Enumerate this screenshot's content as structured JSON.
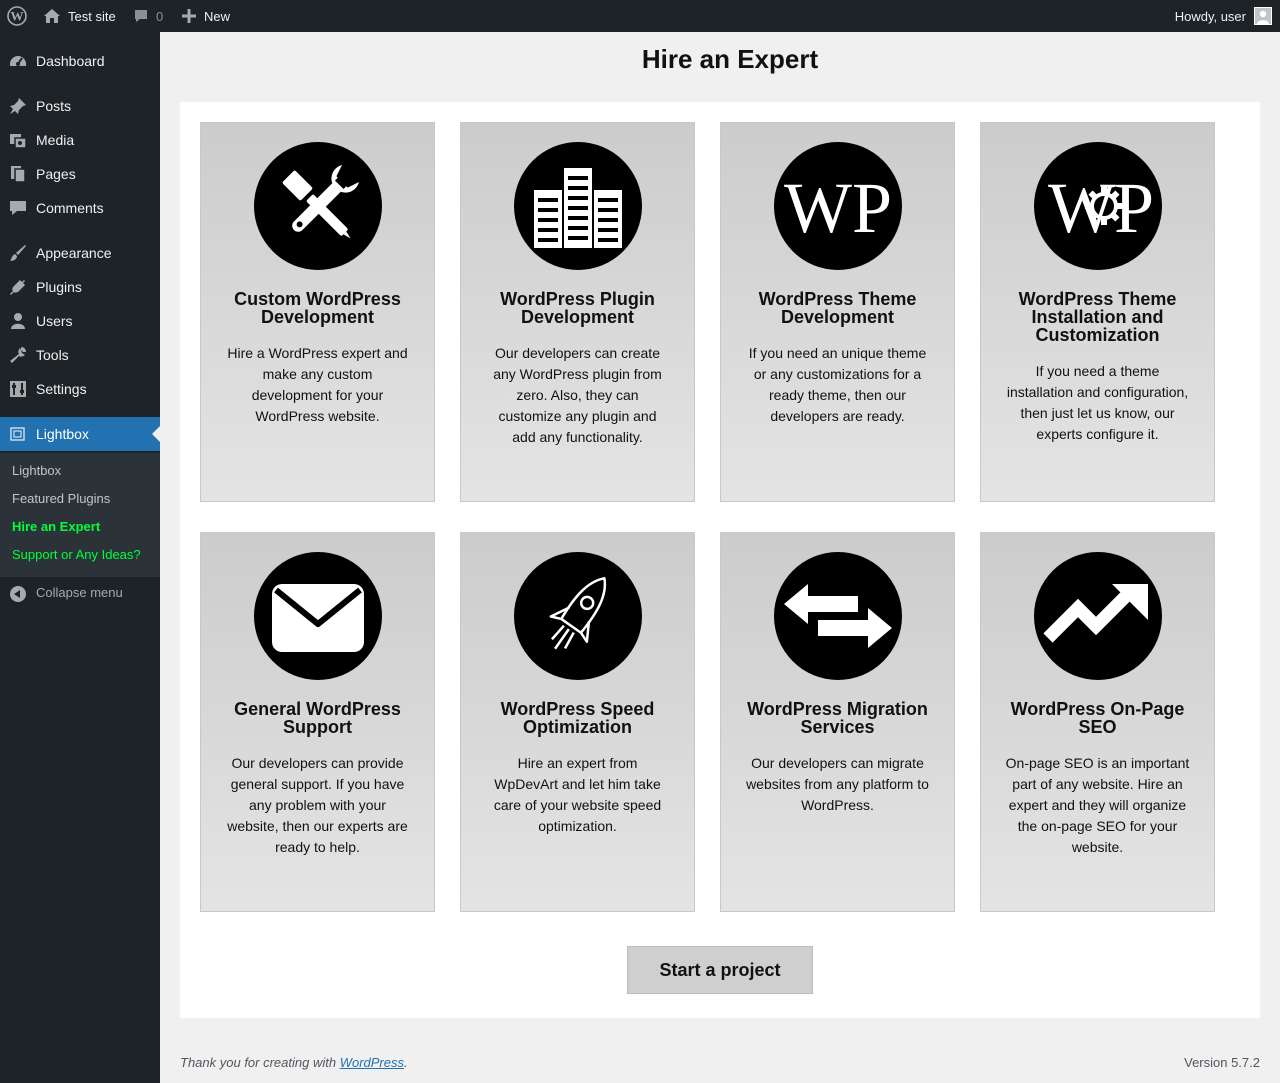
{
  "admin_bar": {
    "wp_logo": "wordpress-icon",
    "site_name": "Test site",
    "comments_count": "0",
    "new_label": "New",
    "greeting": "Howdy, user"
  },
  "sidebar": {
    "items": [
      {
        "label": "Dashboard",
        "icon": "dashboard-icon"
      },
      {
        "label": "Posts",
        "icon": "pin-icon"
      },
      {
        "label": "Media",
        "icon": "media-icon"
      },
      {
        "label": "Pages",
        "icon": "pages-icon"
      },
      {
        "label": "Comments",
        "icon": "comment-icon"
      },
      {
        "label": "Appearance",
        "icon": "brush-icon"
      },
      {
        "label": "Plugins",
        "icon": "plug-icon"
      },
      {
        "label": "Users",
        "icon": "user-icon"
      },
      {
        "label": "Tools",
        "icon": "wrench-icon"
      },
      {
        "label": "Settings",
        "icon": "sliders-icon"
      },
      {
        "label": "Lightbox",
        "icon": "lightbox-icon"
      }
    ],
    "submenu": [
      "Lightbox",
      "Featured Plugins",
      "Hire an Expert",
      "Support or Any Ideas?"
    ],
    "collapse_label": "Collapse menu"
  },
  "page": {
    "title": "Hire an Expert",
    "cards": [
      {
        "title": "Custom WordPress Development",
        "text": "Hire a WordPress expert and make any custom development for your WordPress website.",
        "icon": "tools-icon"
      },
      {
        "title": "WordPress Plugin Development",
        "text": "Our developers can create any WordPress plugin from zero. Also, they can customize any plugin and add any functionality.",
        "icon": "buildings-icon"
      },
      {
        "title": "WordPress Theme Development",
        "text": "If you need an unique theme or any customizations for a ready theme, then our developers are ready.",
        "icon": "wp-letters-icon"
      },
      {
        "title": "WordPress Theme Installation and Customization",
        "text": "If you need a theme installation and configuration, then just let us know, our experts configure it.",
        "icon": "wp-gear-icon"
      },
      {
        "title": "General WordPress Support",
        "text": "Our developers can provide general support. If you have any problem with your website, then our experts are ready to help.",
        "icon": "envelope-icon"
      },
      {
        "title": "WordPress Speed Optimization",
        "text": "Hire an expert from WpDevArt and let him take care of your website speed optimization.",
        "icon": "rocket-icon"
      },
      {
        "title": "WordPress Migration Services",
        "text": "Our developers can migrate websites from any platform to WordPress.",
        "icon": "arrows-icon"
      },
      {
        "title": "WordPress On-Page SEO",
        "text": "On-page SEO is an important part of any website. Hire an expert and they will organize the on-page SEO for your website.",
        "icon": "trend-up-icon"
      }
    ],
    "button_label": "Start a project"
  },
  "footer": {
    "thanks_prefix": "Thank you for creating with ",
    "wp_link": "WordPress",
    "thanks_suffix": ".",
    "version": "Version 5.7.2"
  }
}
